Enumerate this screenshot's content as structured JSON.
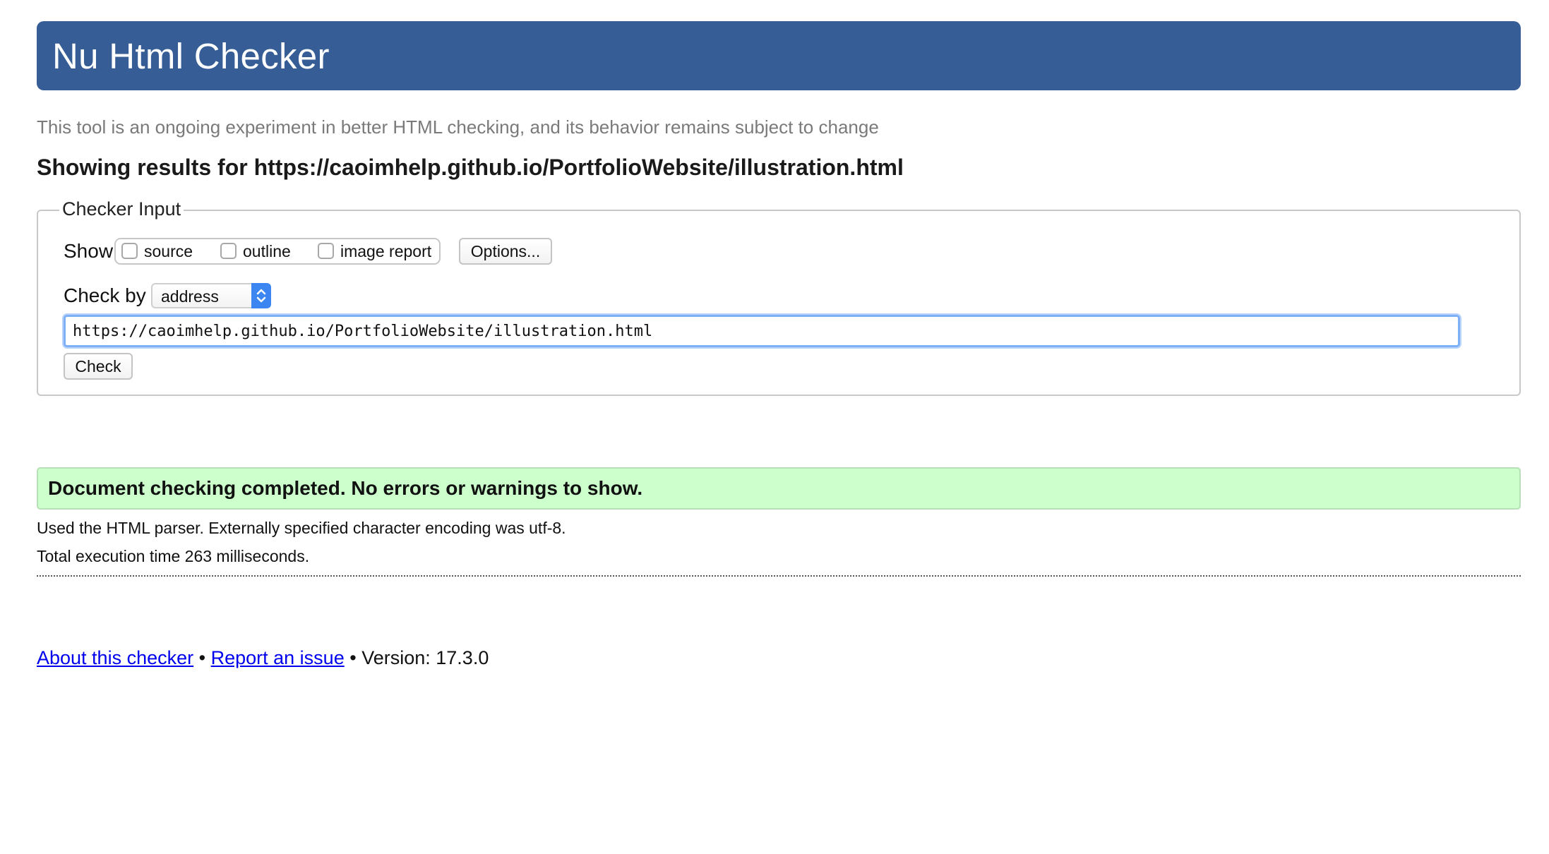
{
  "header": {
    "title": "Nu Html Checker",
    "background_color": "#365d95"
  },
  "tagline": "This tool is an ongoing experiment in better HTML checking, and its behavior remains subject to change",
  "results_heading": "Showing results for https://caoimhelp.github.io/PortfolioWebsite/illustration.html",
  "checker_input": {
    "legend": "Checker Input",
    "show_label": "Show",
    "show_options": [
      {
        "label": "source",
        "checked": false
      },
      {
        "label": "outline",
        "checked": false
      },
      {
        "label": "image report",
        "checked": false
      }
    ],
    "options_button": "Options...",
    "check_by_label": "Check by",
    "check_by_selected": "address",
    "url_value": "https://caoimhelp.github.io/PortfolioWebsite/illustration.html",
    "check_button": "Check"
  },
  "result": {
    "message": "Document checking completed. No errors or warnings to show.",
    "background_color": "#ccffcc",
    "parser_info": "Used the HTML parser. Externally specified character encoding was utf-8.",
    "execution_time": "Total execution time 263 milliseconds."
  },
  "footer": {
    "about_link": "About this checker",
    "separator": "•",
    "report_link": "Report an issue",
    "version": "Version: 17.3.0"
  }
}
